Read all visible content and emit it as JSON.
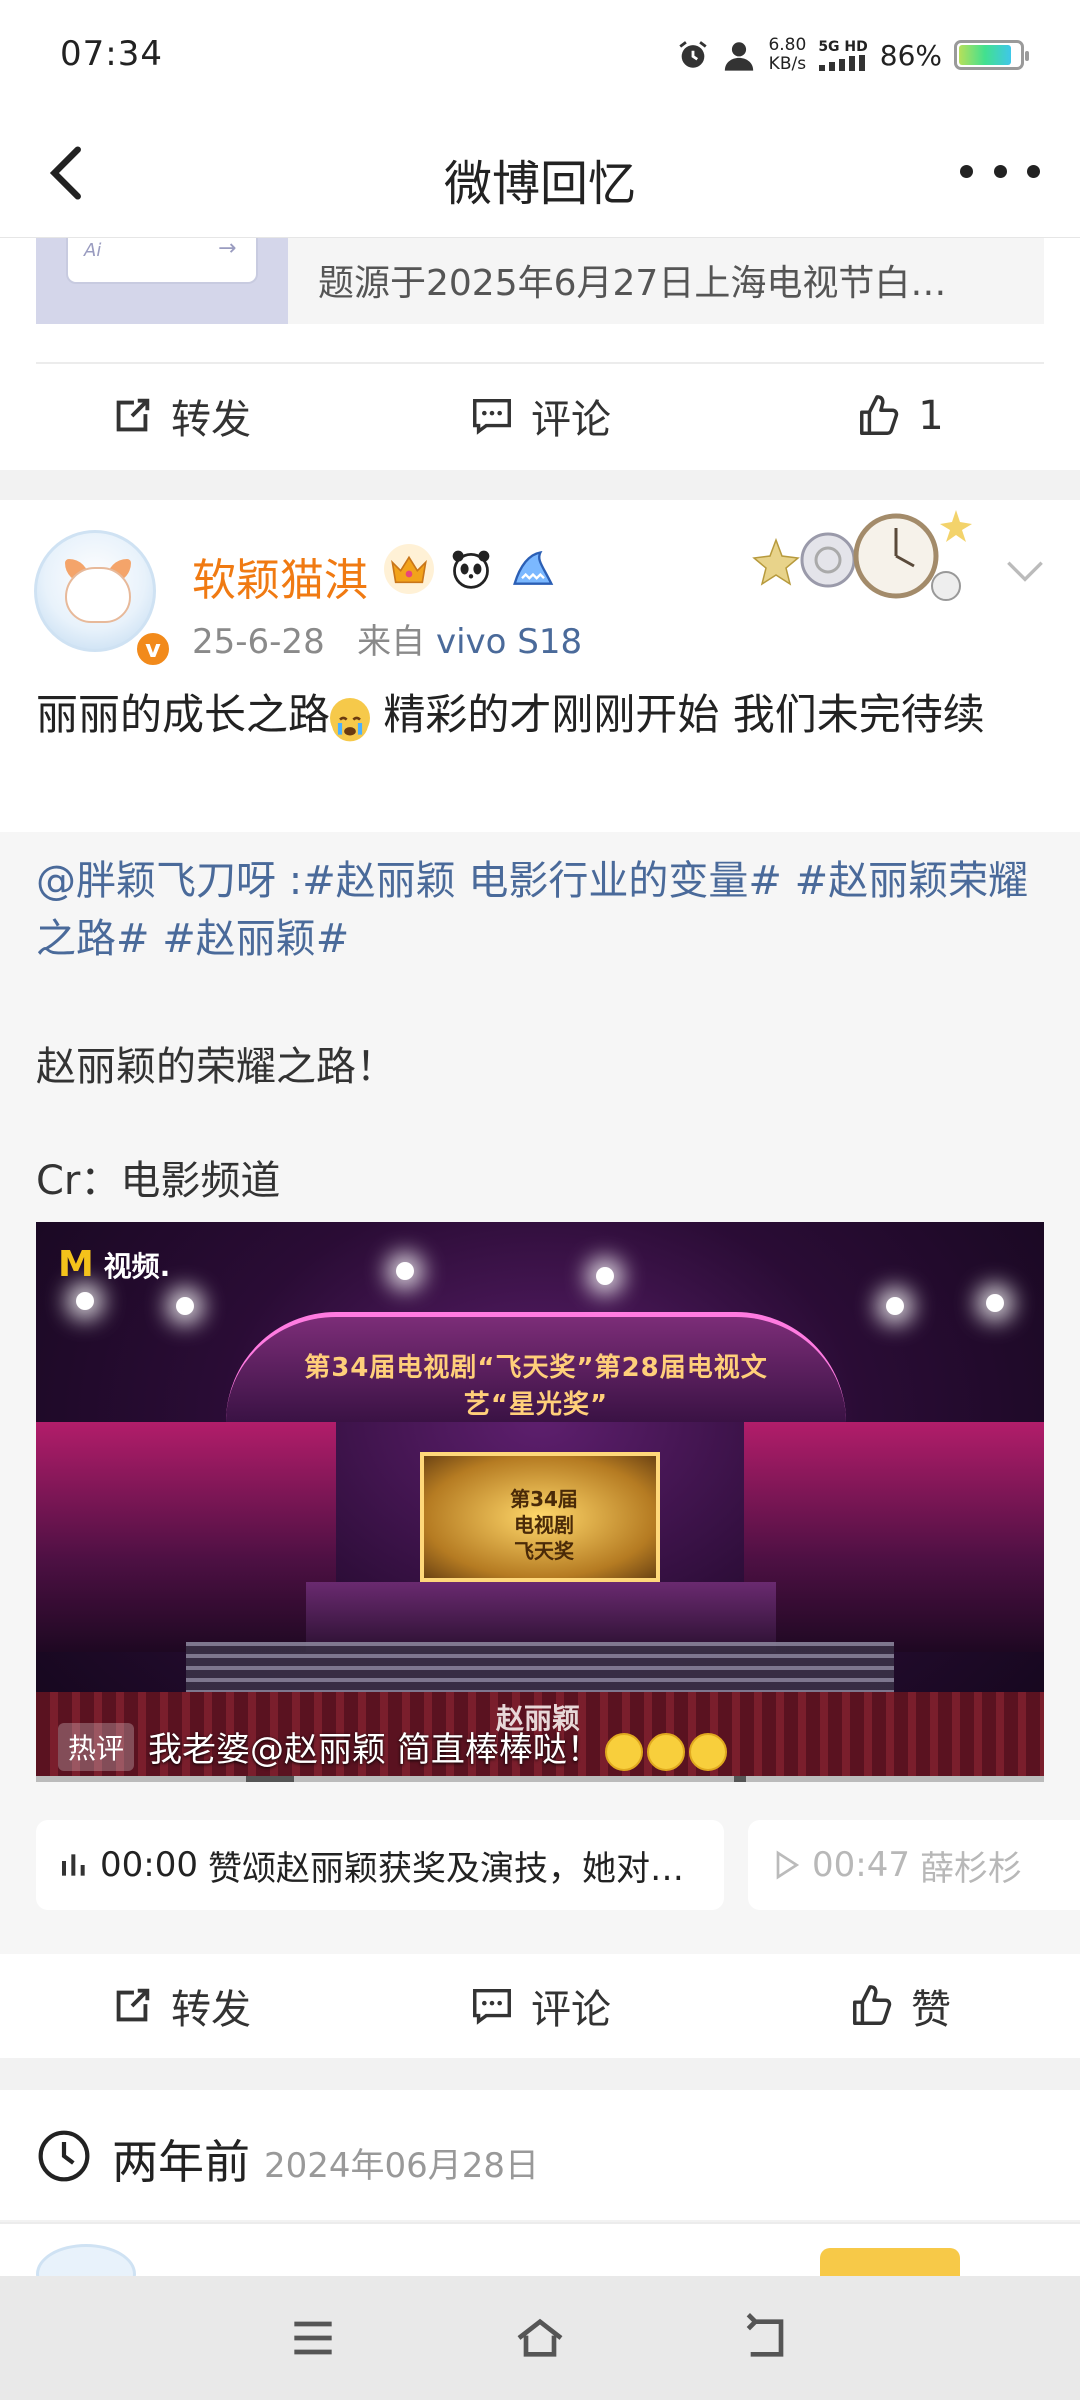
{
  "status_bar": {
    "time": "07:34",
    "net_speed_value": "6.80",
    "net_speed_unit": "KB/s",
    "signal_label": "5G HD",
    "battery_pct": "86%",
    "battery_level": 0.86
  },
  "header": {
    "title": "微博回忆",
    "back_icon": "chevron-left-icon",
    "more_icon": "more-dots-icon"
  },
  "card1": {
    "quote_thumb_label": "Ai",
    "quote_text": "题源于2025年6月27日上海电视节白…",
    "actions": {
      "repost": "转发",
      "comment": "评论",
      "like": "1"
    }
  },
  "card2": {
    "username": "软颖猫淇",
    "verified_badge": "v",
    "meta_date": "25-6-28",
    "meta_from": "来自",
    "meta_source": "vivo S18",
    "post_text_1": "丽丽的成长之路",
    "post_text_2": " 精彩的才刚刚开始 我们未完待续",
    "retweet": {
      "mention": "@胖颖飞刀呀",
      "sep": " :",
      "tag1": "#赵丽颖 电影行业的变量#",
      "tag2": "#赵丽颖荣耀之路#",
      "tag3": "#赵丽颖#",
      "plain": "赵丽颖的荣耀之路！",
      "cr": "Cr：电影频道",
      "video": {
        "logo": "视频.",
        "arch_text": "第34届电视剧“飞天奖”第28届电视文艺“星光奖”",
        "screen_text_1": "第34届",
        "screen_text_2": "电视剧",
        "screen_text_3": "飞天奖",
        "name_caption": "赵丽颖",
        "hot_tag": "热评",
        "hot_comment": "我老婆@赵丽颖 简直棒棒哒！"
      },
      "chips": [
        {
          "time": "00:00",
          "text": "赞颂赵丽颖获奖及演技，她对…",
          "icon": "audio-bars-icon"
        },
        {
          "time": "00:47",
          "text": "薛杉杉",
          "icon": "play-icon"
        }
      ]
    },
    "actions": {
      "repost": "转发",
      "comment": "评论",
      "like": "赞"
    }
  },
  "section": {
    "title": "两年前",
    "date": "2024年06月28日"
  },
  "navbar": {
    "menu_icon": "menu-icon",
    "home_icon": "home-icon",
    "back_icon": "back-icon"
  }
}
